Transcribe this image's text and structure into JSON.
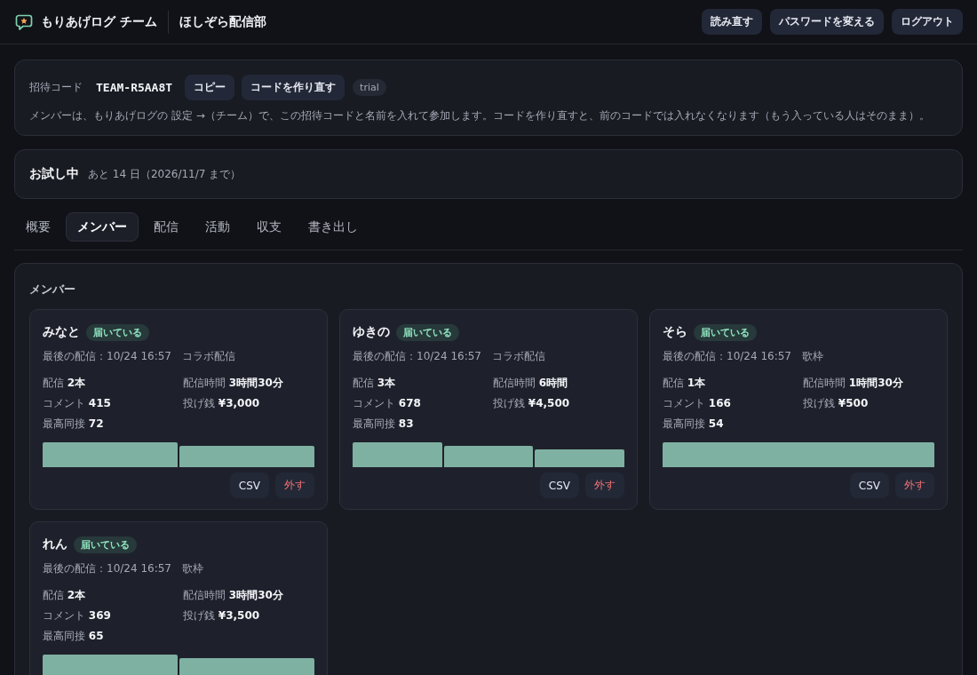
{
  "header": {
    "app_name": "もりあげログ チーム",
    "team_name": "ほしぞら配信部",
    "buttons": [
      "読み直す",
      "パスワードを変える",
      "ログアウト"
    ]
  },
  "invite": {
    "label": "招待コード",
    "code": "TEAM-R5AA8T",
    "buttons": [
      "コピー",
      "コードを作り直す"
    ],
    "plan_badge": "trial",
    "note": "メンバーは、もりあげログの 設定 →（チーム）で、この招待コードと名前を入れて参加します。コードを作り直すと、前のコードでは入れなくなります（もう入っている人はそのまま）。"
  },
  "trial": {
    "title": "お試し中",
    "remaining": "あと 14 日（2026/11/7 まで）"
  },
  "tabs": [
    {
      "label": "概要",
      "selected": false
    },
    {
      "label": "メンバー",
      "selected": true
    },
    {
      "label": "配信",
      "selected": false
    },
    {
      "label": "活動",
      "selected": false
    },
    {
      "label": "収支",
      "selected": false
    },
    {
      "label": "書き出し",
      "selected": false
    }
  ],
  "members_panel": {
    "title": "メンバー",
    "members": [
      {
        "name": "みなと",
        "badge": "届いている",
        "last_stream": "最後の配信：10/24 16:57",
        "stream_type": "コラボ配信",
        "stats": [
          {
            "label": "配信",
            "value": "2本"
          },
          {
            "label": "配信時間",
            "value": "3時間30分"
          },
          {
            "label": "コメント",
            "value": "415"
          },
          {
            "label": "投げ銭",
            "value": "¥3,000"
          },
          {
            "label": "最高同接",
            "value": "72"
          }
        ],
        "actions": [
          {
            "label": "CSV",
            "kind": "normal"
          },
          {
            "label": "外す",
            "kind": "danger"
          }
        ]
      },
      {
        "name": "ゆきの",
        "badge": "届いている",
        "last_stream": "最後の配信：10/24 16:57",
        "stream_type": "コラボ配信",
        "stats": [
          {
            "label": "配信",
            "value": "3本"
          },
          {
            "label": "配信時間",
            "value": "6時間"
          },
          {
            "label": "コメント",
            "value": "678"
          },
          {
            "label": "投げ銭",
            "value": "¥4,500"
          },
          {
            "label": "最高同接",
            "value": "83"
          }
        ],
        "actions": [
          {
            "label": "CSV",
            "kind": "normal"
          },
          {
            "label": "外す",
            "kind": "danger"
          }
        ]
      },
      {
        "name": "そら",
        "badge": "届いている",
        "last_stream": "最後の配信：10/24 16:57",
        "stream_type": "歌枠",
        "stats": [
          {
            "label": "配信",
            "value": "1本"
          },
          {
            "label": "配信時間",
            "value": "1時間30分"
          },
          {
            "label": "コメント",
            "value": "166"
          },
          {
            "label": "投げ銭",
            "value": "¥500"
          },
          {
            "label": "最高同接",
            "value": "54"
          }
        ],
        "actions": [
          {
            "label": "CSV",
            "kind": "normal"
          },
          {
            "label": "外す",
            "kind": "danger"
          }
        ]
      },
      {
        "name": "れん",
        "badge": "届いている",
        "last_stream": "最後の配信：10/24 16:57",
        "stream_type": "歌枠",
        "stats": [
          {
            "label": "配信",
            "value": "2本"
          },
          {
            "label": "配信時間",
            "value": "3時間30分"
          },
          {
            "label": "コメント",
            "value": "369"
          },
          {
            "label": "投げ銭",
            "value": "¥3,500"
          },
          {
            "label": "最高同接",
            "value": "65"
          }
        ]
      }
    ]
  }
}
